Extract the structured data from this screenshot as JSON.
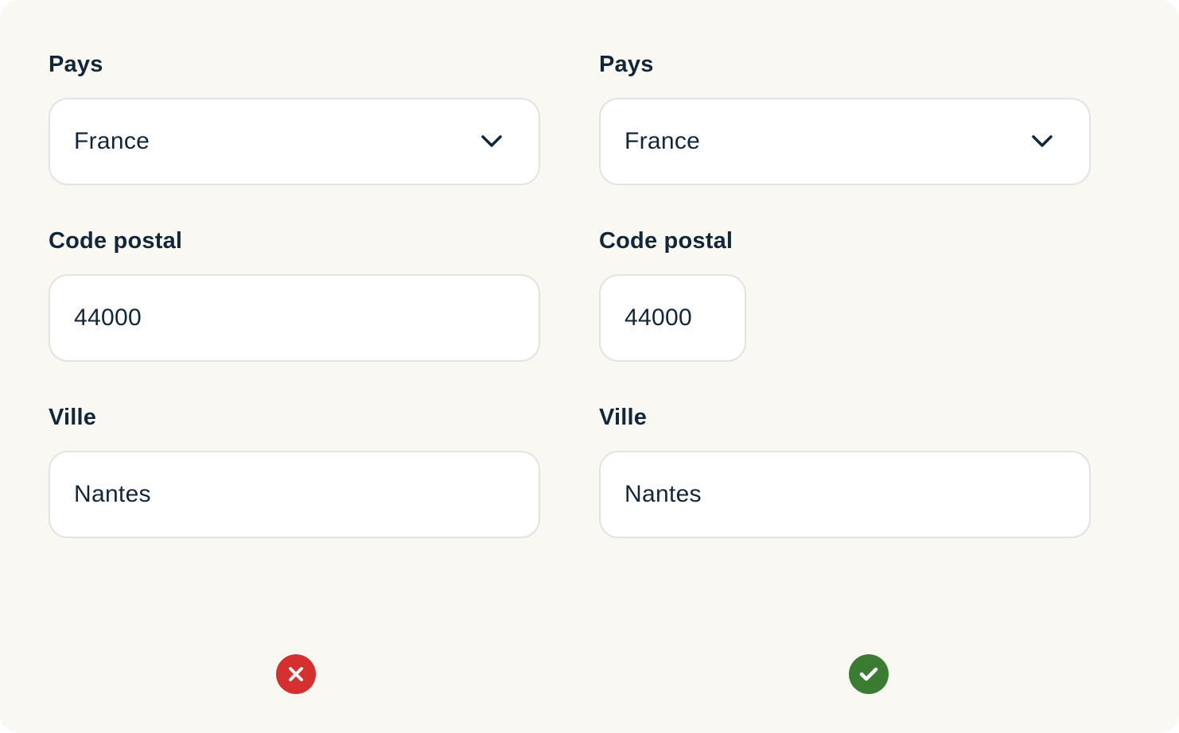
{
  "colors": {
    "background": "#f9f8f2",
    "text": "#12263a",
    "field_border": "#e3e3e3",
    "error": "#d3302f",
    "success": "#3a7d32"
  },
  "left_form": {
    "country": {
      "label": "Pays",
      "value": "France",
      "icon": "chevron-down-icon"
    },
    "postal_code": {
      "label": "Code postal",
      "value": "44000"
    },
    "city": {
      "label": "Ville",
      "value": "Nantes"
    },
    "status_icon": "close-icon"
  },
  "right_form": {
    "country": {
      "label": "Pays",
      "value": "France",
      "icon": "chevron-down-icon"
    },
    "postal_code": {
      "label": "Code postal",
      "value": "44000"
    },
    "city": {
      "label": "Ville",
      "value": "Nantes"
    },
    "status_icon": "check-icon"
  }
}
